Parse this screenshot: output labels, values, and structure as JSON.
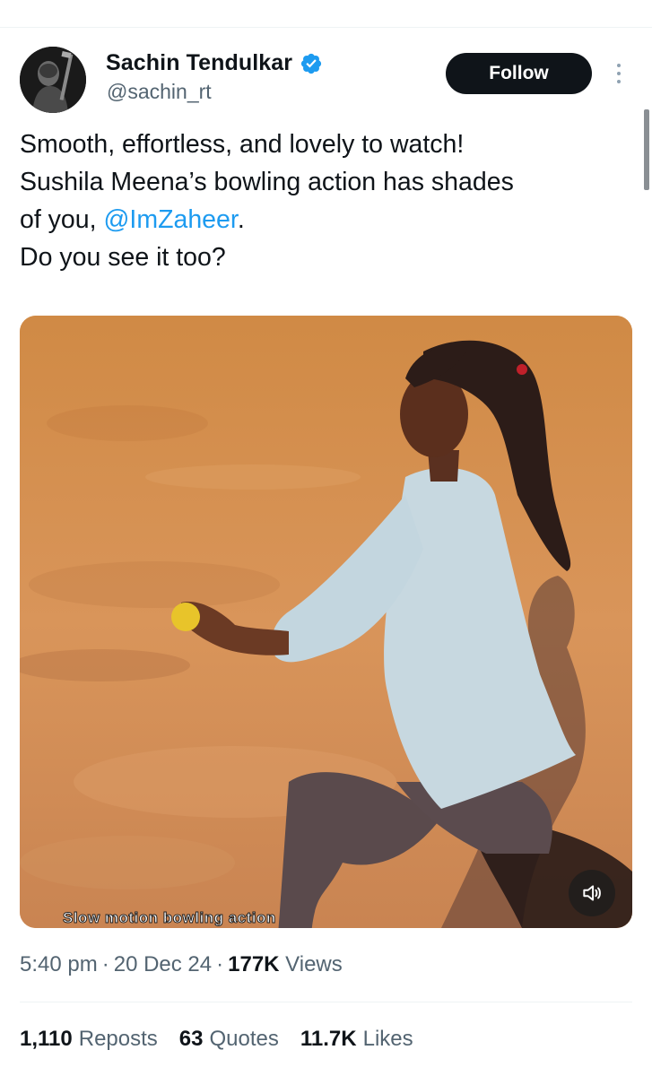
{
  "author": {
    "name": "Sachin Tendulkar",
    "handle": "@sachin_rt",
    "verified": true
  },
  "actions": {
    "follow_label": "Follow"
  },
  "tweet": {
    "line1": "Smooth, effortless, and lovely to watch!",
    "line2": "Sushila Meena’s bowling action has shades",
    "line3_prefix": "of you, ",
    "mention": "@ImZaheer",
    "line3_suffix": ".",
    "line4": "Do you see it too?"
  },
  "media": {
    "caption_overlay": "Slow motion bowling action"
  },
  "meta": {
    "time": "5:40 pm",
    "date": "20 Dec 24",
    "views_count": "177K",
    "views_label": "Views",
    "separator": "·"
  },
  "stats": {
    "reposts_count": "1,110",
    "reposts_label": "Reposts",
    "quotes_count": "63",
    "quotes_label": "Quotes",
    "likes_count": "11.7K",
    "likes_label": "Likes"
  },
  "colors": {
    "text_primary": "#0f1419",
    "text_secondary": "#536471",
    "link": "#1d9bf0",
    "verified_badge": "#1d9bf0",
    "follow_button": "#0f1419"
  },
  "icons": {
    "verified": "verified-badge-icon",
    "more": "more-options-icon",
    "mute": "speaker-muted-icon"
  }
}
